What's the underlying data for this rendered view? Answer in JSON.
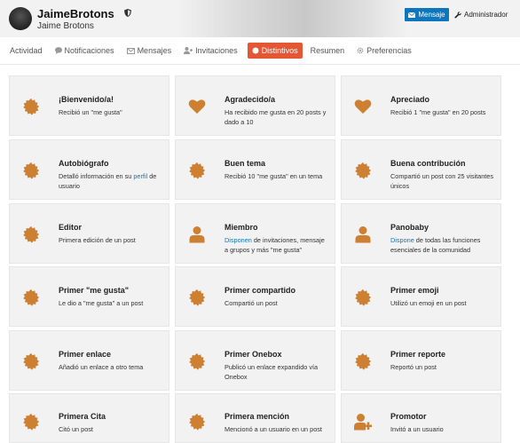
{
  "header": {
    "username": "JaimeBrotons",
    "fullname": "Jaime Brotons",
    "message_button": "Mensaje",
    "admin_button": "Administrador"
  },
  "nav": {
    "items": [
      {
        "label": "Actividad",
        "icon": ""
      },
      {
        "label": "Notificaciones",
        "icon": "comment-icon"
      },
      {
        "label": "Mensajes",
        "icon": "envelope-icon"
      },
      {
        "label": "Invitaciones",
        "icon": "user-plus-icon"
      },
      {
        "label": "Distintivos",
        "icon": "certificate-icon",
        "active": true
      },
      {
        "label": "Resumen",
        "icon": ""
      },
      {
        "label": "Preferencias",
        "icon": "gear-icon"
      }
    ]
  },
  "colors": {
    "badge_bronze": "#cd7f32",
    "accent": "#e45735",
    "link": "#0e76bd"
  },
  "badges": [
    {
      "title": "¡Bienvenido/a!",
      "desc": "Recibió un \"me gusta\"",
      "icon": "certificate-icon"
    },
    {
      "title": "Agradecido/a",
      "desc": "Ha recibido me gusta en 20 posts y dado a 10",
      "icon": "heart-icon"
    },
    {
      "title": "Apreciado",
      "desc": "Recibió 1 \"me gusta\" en 20 posts",
      "icon": "heart-icon"
    },
    {
      "title": "Autobiógrafo",
      "desc_pre": "Detalló información en su ",
      "desc_link": "perfil",
      "desc_post": " de usuario",
      "icon": "certificate-icon"
    },
    {
      "title": "Buen tema",
      "desc": "Recibió 10 \"me gusta\" en un tema",
      "icon": "certificate-icon"
    },
    {
      "title": "Buena contribución",
      "desc": "Compartió un post con 25 visitantes únicos",
      "icon": "certificate-icon"
    },
    {
      "title": "Editor",
      "desc": "Primera edición de un post",
      "icon": "certificate-icon"
    },
    {
      "title": "Miembro",
      "desc_link": "Disponen",
      "desc_post": " de invitaciones, mensaje a grupos y más \"me gusta\"",
      "icon": "user-icon"
    },
    {
      "title": "Panobaby",
      "desc_link": "Dispone",
      "desc_post": " de todas las funciones esenciales de la comunidad",
      "icon": "user-icon"
    },
    {
      "title": "Primer \"me gusta\"",
      "desc": "Le dio a \"me gusta\" a un post",
      "icon": "certificate-icon"
    },
    {
      "title": "Primer compartido",
      "desc": "Compartió un post",
      "icon": "certificate-icon"
    },
    {
      "title": "Primer emoji",
      "desc": "Utilizó un emoji en un post",
      "icon": "certificate-icon"
    },
    {
      "title": "Primer enlace",
      "desc": "Añadió un enlace a otro tema",
      "icon": "certificate-icon"
    },
    {
      "title": "Primer Onebox",
      "desc": "Publicó un enlace expandido vía Onebox",
      "icon": "certificate-icon"
    },
    {
      "title": "Primer reporte",
      "desc": "Reportó un post",
      "icon": "certificate-icon"
    },
    {
      "title": "Primera Cita",
      "desc": "Citó un post",
      "icon": "certificate-icon"
    },
    {
      "title": "Primera mención",
      "desc": "Mencionó a un usuario en un post",
      "icon": "certificate-icon"
    },
    {
      "title": "Promotor",
      "desc": "Invitó a un usuario",
      "icon": "user-plus-icon"
    }
  ]
}
